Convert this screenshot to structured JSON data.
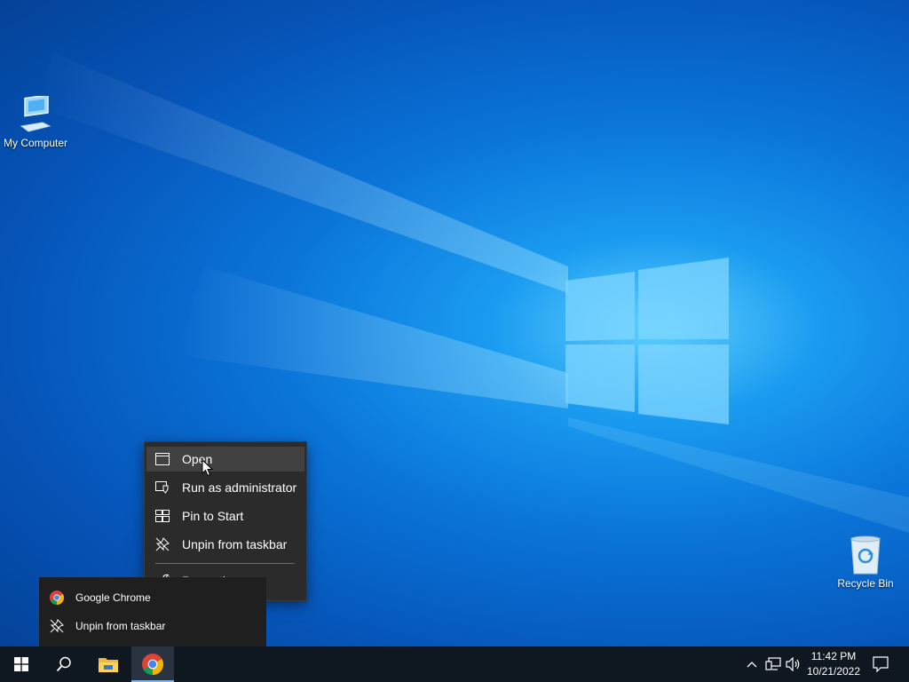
{
  "desktop": {
    "icons": [
      {
        "label": "My Computer",
        "icon": "computer-icon"
      },
      {
        "label": "Recycle Bin",
        "icon": "recycle-bin-icon"
      }
    ]
  },
  "context_menu": {
    "items": [
      {
        "label": "Open",
        "icon": "window-icon",
        "highlighted": true
      },
      {
        "label": "Run as administrator",
        "icon": "shield-icon"
      },
      {
        "label": "Pin to Start",
        "icon": "pin-to-start-icon"
      },
      {
        "label": "Unpin from taskbar",
        "icon": "unpin-icon"
      },
      {
        "label": "Properties",
        "icon": "wrench-icon"
      }
    ]
  },
  "jump_list": {
    "items": [
      {
        "label": "Google Chrome",
        "icon": "chrome-icon"
      },
      {
        "label": "Unpin from taskbar",
        "icon": "unpin-icon"
      }
    ]
  },
  "taskbar": {
    "buttons": [
      "start-icon",
      "search-icon",
      "file-explorer-icon",
      "chrome-icon"
    ],
    "active": "chrome-icon",
    "tray_icons": [
      "chevron-up-icon",
      "network-icon",
      "volume-icon",
      "notification-icon"
    ],
    "clock": {
      "time": "11:42 PM",
      "date": "10/21/2022"
    }
  },
  "colors": {
    "accent": "#0a74d8",
    "menu_bg": "#2b2b2b",
    "taskbar_bg": "#0f1720"
  }
}
